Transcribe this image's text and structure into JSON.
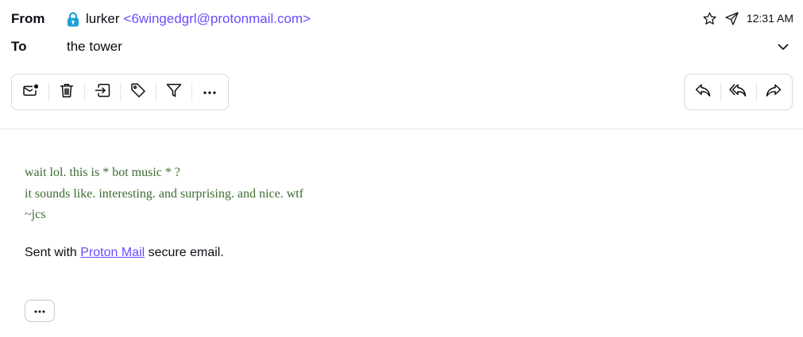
{
  "header": {
    "from_label": "From",
    "to_label": "To",
    "sender_name": "lurker",
    "sender_address": "<6wingedgrl@protonmail.com>",
    "recipient": "the tower",
    "time": "12:31 AM"
  },
  "toolbar_left": [
    "mark-unread-icon",
    "trash-icon",
    "move-to-icon",
    "label-icon",
    "filter-icon",
    "more-icon"
  ],
  "toolbar_right": [
    "reply-icon",
    "reply-all-icon",
    "forward-icon"
  ],
  "message": {
    "lines": [
      "wait lol. this is * bot music * ?",
      "it sounds like. interesting. and surprising. and nice. wtf",
      "~jcs"
    ],
    "signature_prefix": "Sent with ",
    "signature_link": "Proton Mail",
    "signature_suffix": " secure email."
  },
  "more_button": "···",
  "colors": {
    "accent": "#6d4aff",
    "body_text": "#3d6b2f",
    "lock": "#1ea1d8",
    "border": "#d9d9de"
  }
}
